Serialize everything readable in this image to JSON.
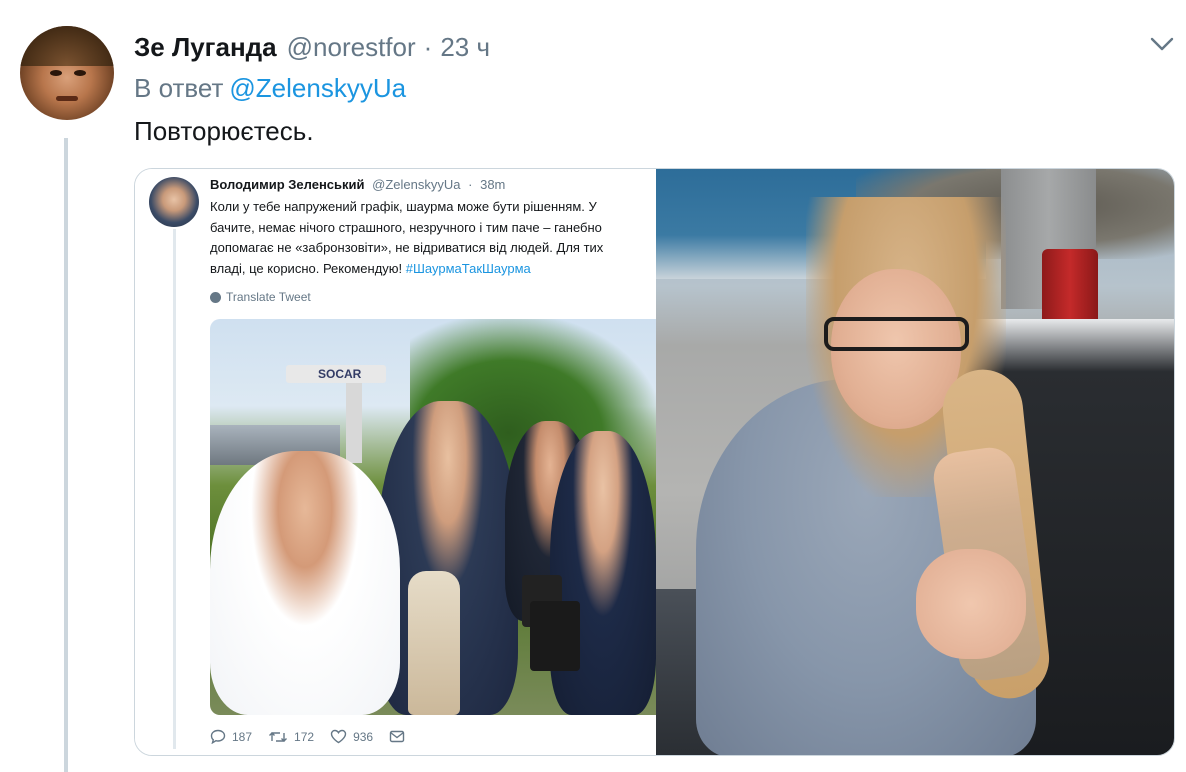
{
  "tweet": {
    "display_name": "Зе Луганда",
    "handle": "@norestfor",
    "separator": "·",
    "time": "23 ч",
    "reply_prefix": "В ответ",
    "reply_mention": "@ZelenskyyUa",
    "text": "Повторюєтесь."
  },
  "embedded_tweet": {
    "name": "Володимир Зеленський",
    "handle": "@ZelenskyyUa",
    "separator": "·",
    "time": "38m",
    "body_line1": "Коли у тебе напружений графік, шаурма може бути рішенням. У",
    "body_line2": "бачите, немає нічого страшного, незручного і тим паче – ганебно",
    "body_line3": "допомагає не «забронзовіти», не відриватися від людей. Для тих",
    "body_line4": "владі, це корисно. Рекомендую!",
    "hashtag": "#ШаурмаТакШаурма",
    "translate": "Translate Tweet",
    "photo_sign": "SOCAR",
    "replies": "187",
    "retweets": "172",
    "likes": "936"
  },
  "icons": {
    "more": "chevron-down-icon",
    "translate": "globe-icon",
    "reply": "reply-icon",
    "retweet": "retweet-icon",
    "like": "heart-icon",
    "dm": "mail-icon"
  },
  "colors": {
    "link": "#1b95e0",
    "secondary_text": "#657786",
    "thread_line": "#ccd6dd"
  }
}
